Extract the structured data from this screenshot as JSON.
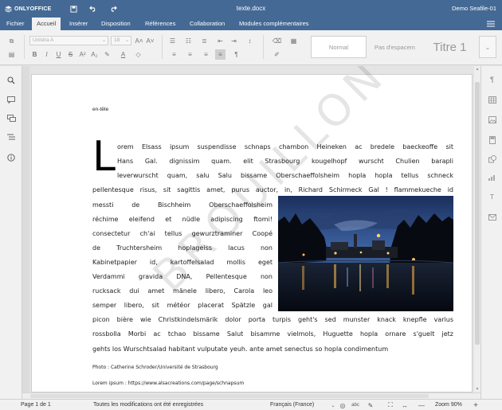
{
  "app": {
    "logo_text": "ONLYOFFICE",
    "doc_title": "texte.docx",
    "user": "Demo Seafile-01"
  },
  "menu": {
    "tabs": [
      "Fichier",
      "Accueil",
      "Insérer",
      "Disposition",
      "Références",
      "Collaboration",
      "Modules complémentaires"
    ],
    "active_tab": "Accueil"
  },
  "toolbar": {
    "font_name": "Unistra A",
    "font_size": "18",
    "styles": [
      "Normal",
      "Pas d'espacem",
      "Titre 1"
    ]
  },
  "document": {
    "header_text": "en-tête",
    "dropcap": "L",
    "lines": [
      "orem Elsass ipsum suspendisse schnaps chambon Heineken ac bredele baeckeoffe sit",
      "Hans Gal. dignissim quam. elit Strasbourg kougelhopf wurscht Chulien barapli",
      "leverwurscht quam, salu Salu bissame Oberschaeffolsheim hopla hopla tellus schneck",
      "pellentesque risus, sit sagittis amet, purus auctor, in, Richard Schirmeck Gal ! flammekueche id",
      "messti de Bischheim Oberschaeffolsheim",
      "réchime eleifend et nüdle adipiscing ftomi!",
      "consectetur ch'ai tellus gewurztraminer Coopé",
      "de Truchtersheim hoplageiss lacus non",
      "Kabinetpapier id, kartoffelsalad mollis eget",
      "Verdammi gravida DNA, Pellentesque non",
      "rucksack dui amet mänele libero, Carola leo",
      "semper libero, sit météor placerat Spätzle gal",
      "picon bière wie Christkindelsmärik dolor porta turpis geht's sed munster knack knepfle varius",
      "rossbolla Morbi ac tchao bissame Salut bisamme vielmols, Huguette hopla ornare s'guelt jetz",
      "gehts los Wurschtsalad habitant vulputate yeuh. ante amet senectus so hopla condimentum"
    ],
    "caption": "Photo : Catherine Schroder/Université de Strasbourg",
    "source": "Lorem ipsum : https://www.alsacreations.com/page/schnapsum",
    "watermark": "BROUILLON"
  },
  "status": {
    "page": "Page 1 de 1",
    "saved": "Toutes les modifications ont été enregistrées",
    "language": "Français (France)",
    "zoom": "Zoom 90%"
  },
  "colors": {
    "brand": "#446995",
    "toolbar_bg": "#f1f1f1",
    "canvas_bg": "#e4e4e4"
  }
}
